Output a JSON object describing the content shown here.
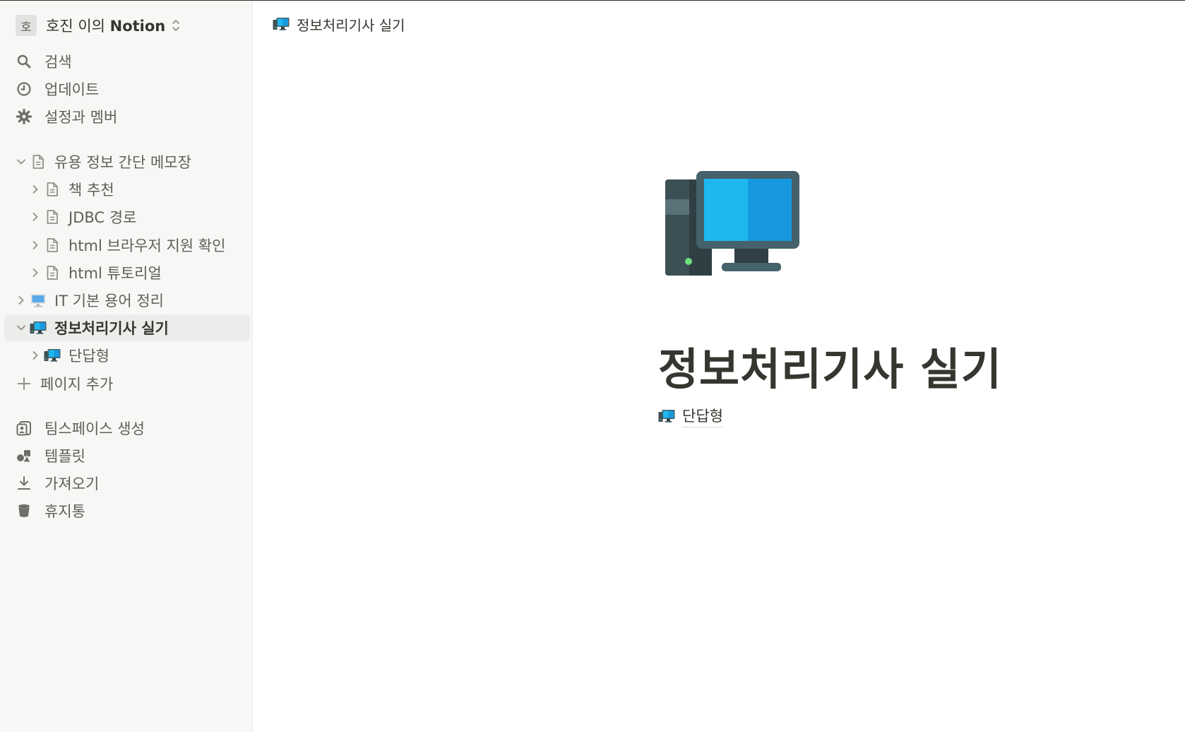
{
  "workspace": {
    "avatar": "호",
    "name_prefix": "호진 이의 ",
    "name_brand": "Notion"
  },
  "sidebar": {
    "top_items": [
      {
        "label": "검색",
        "icon": "search-icon"
      },
      {
        "label": "업데이트",
        "icon": "clock-icon"
      },
      {
        "label": "설정과 멤버",
        "icon": "gear-icon"
      }
    ],
    "pages": [
      {
        "label": "유용 정보 간단 메모장",
        "icon": "page-icon",
        "expanded": true
      },
      {
        "label": "책 추천",
        "icon": "page-icon"
      },
      {
        "label": "JDBC 경로",
        "icon": "page-icon"
      },
      {
        "label": "html 브라우저 지원 확인",
        "icon": "page-icon"
      },
      {
        "label": "html 튜토리얼",
        "icon": "page-icon"
      },
      {
        "label": "IT 기본 용어 정리",
        "icon": "monitor-emoji-icon"
      },
      {
        "label": "정보처리기사 실기",
        "icon": "desktop-computer-icon",
        "expanded": true,
        "selected": true
      },
      {
        "label": "단답형",
        "icon": "desktop-computer-icon"
      }
    ],
    "add_page": "페이지 추가",
    "bottom_items": [
      {
        "label": "팀스페이스 생성",
        "icon": "teamspace-icon"
      },
      {
        "label": "템플릿",
        "icon": "shapes-icon"
      },
      {
        "label": "가져오기",
        "icon": "download-icon"
      },
      {
        "label": "휴지통",
        "icon": "trash-icon"
      }
    ]
  },
  "main": {
    "breadcrumb": "정보처리기사 실기",
    "title": "정보처리기사 실기",
    "subpages": [
      {
        "label": "단답형",
        "icon": "desktop-computer-icon"
      }
    ]
  },
  "colors": {
    "sidebar_bg": "#f7f7f5",
    "selected_bg": "#ececea",
    "text": "#37352f",
    "muted_text": "#5f5e5b",
    "monitor_screen": "#1eb8ef",
    "monitor_frame": "#456169",
    "tower": "#3c4f55"
  }
}
